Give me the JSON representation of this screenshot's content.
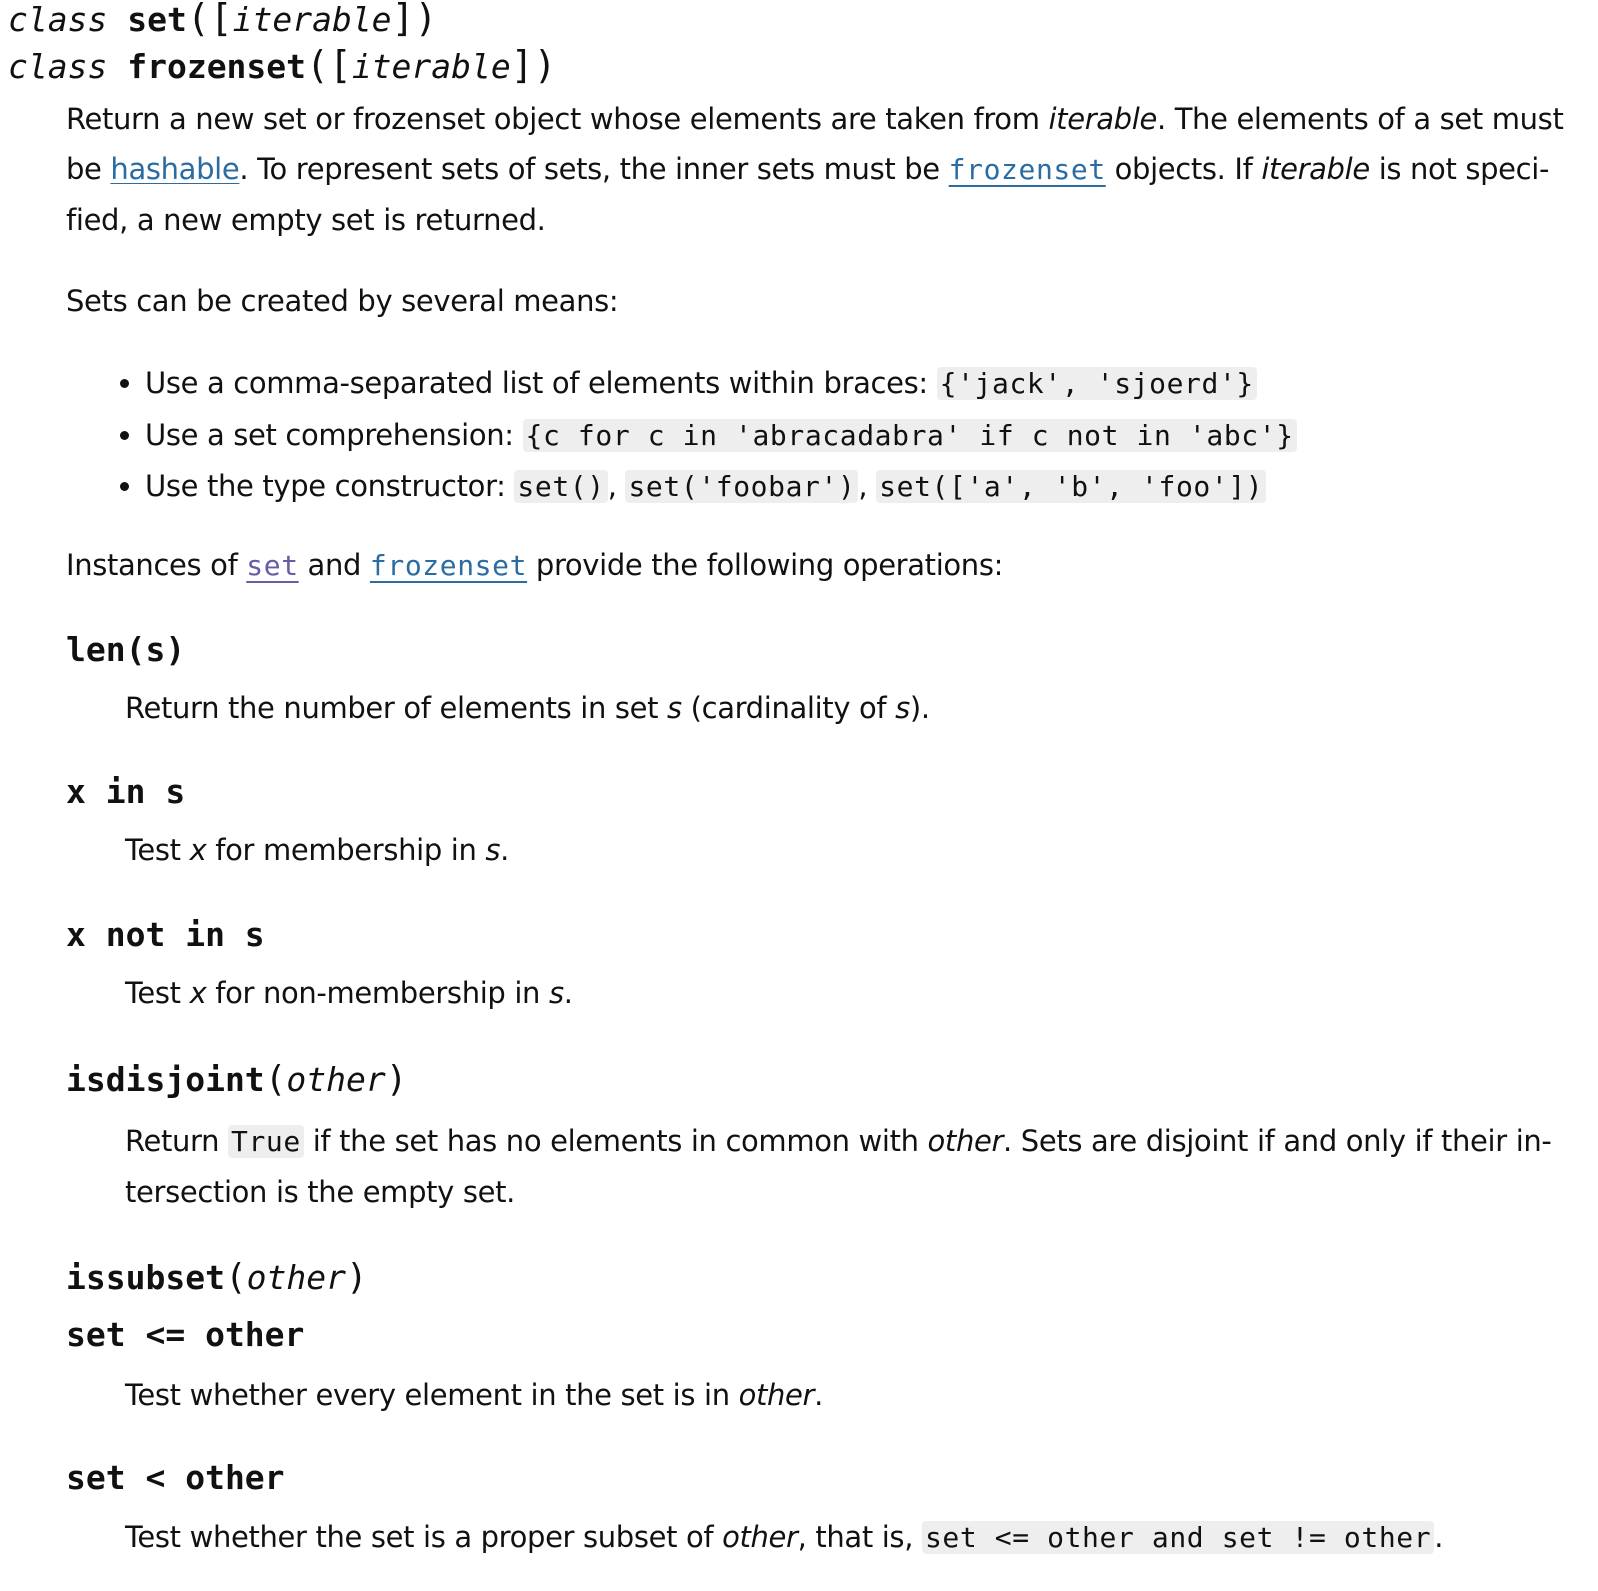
{
  "signatures": [
    {
      "keyword": "class",
      "name": "set",
      "open": "(",
      "bracket_open": "[",
      "param": "iterable",
      "bracket_close": "]",
      "close": ")"
    },
    {
      "keyword": "class",
      "name": "frozenset",
      "open": "(",
      "bracket_open": "[",
      "param": "iterable",
      "bracket_close": "]",
      "close": ")"
    }
  ],
  "intro": {
    "p1_a": "Return a new set or frozenset object whose elements are taken from ",
    "p1_iterable": "iterable",
    "p1_b": ". The elements of a set must",
    "p2_a": "be ",
    "p2_hashable": "hashable",
    "p2_b": ". To represent sets of sets, the inner sets must be ",
    "p2_frozenset": "frozenset",
    "p2_c": " objects. If ",
    "p2_iterable": "iterable",
    "p2_d": " is not speci-",
    "p3": "fied, a new empty set is returned."
  },
  "means_intro": "Sets can be created by several means:",
  "means": [
    {
      "text": "Use a comma-separated list of elements within braces: ",
      "code": "{'jack', 'sjoerd'}"
    },
    {
      "text": "Use a set comprehension: ",
      "code": "{c for c in 'abracadabra' if c not in 'abc'}"
    },
    {
      "text": "Use the type constructor: ",
      "code1": "set()",
      "sep1": ", ",
      "code2": "set('foobar')",
      "sep2": ", ",
      "code3": "set(['a', 'b', 'foo'])"
    }
  ],
  "instances": {
    "a": "Instances of ",
    "set_link": "set",
    "b": " and ",
    "frozenset_link": "frozenset",
    "c": " provide the following operations:"
  },
  "methods": {
    "len": {
      "head": "len(s)",
      "desc_a": "Return the number of elements in set ",
      "s1": "s",
      "desc_b": " (cardinality of ",
      "s2": "s",
      "desc_c": ")."
    },
    "in": {
      "head": "x in s",
      "desc_a": "Test ",
      "x": "x",
      "desc_b": " for membership in ",
      "s": "s",
      "desc_c": "."
    },
    "not_in": {
      "head": "x not in s",
      "desc_a": "Test ",
      "x": "x",
      "desc_b": " for non-membership in ",
      "s": "s",
      "desc_c": "."
    },
    "isdisjoint": {
      "name": "isdisjoint",
      "open": "(",
      "param": "other",
      "close": ")",
      "line1_a": "Return ",
      "line1_code": "True",
      "line1_b": " if the set has no elements in common with ",
      "line1_other": "other",
      "line1_c": ". Sets are disjoint if and only if their in-",
      "line2": "tersection is the empty set."
    },
    "issubset": {
      "name": "issubset",
      "open": "(",
      "param": "other",
      "close": ")",
      "alt": "set <= other",
      "desc_a": "Test whether every element in the set is in ",
      "other": "other",
      "desc_b": "."
    },
    "proper_subset": {
      "head": "set < other",
      "desc_a": "Test whether the set is a proper subset of ",
      "other": "other",
      "desc_b": ", that is, ",
      "code": "set <= other and set != other",
      "desc_c": "."
    }
  },
  "colors": {
    "link": "#2b6ca3",
    "visited_link": "#6a5aa8",
    "code_bg": "#eeeeee",
    "text": "#111111"
  }
}
